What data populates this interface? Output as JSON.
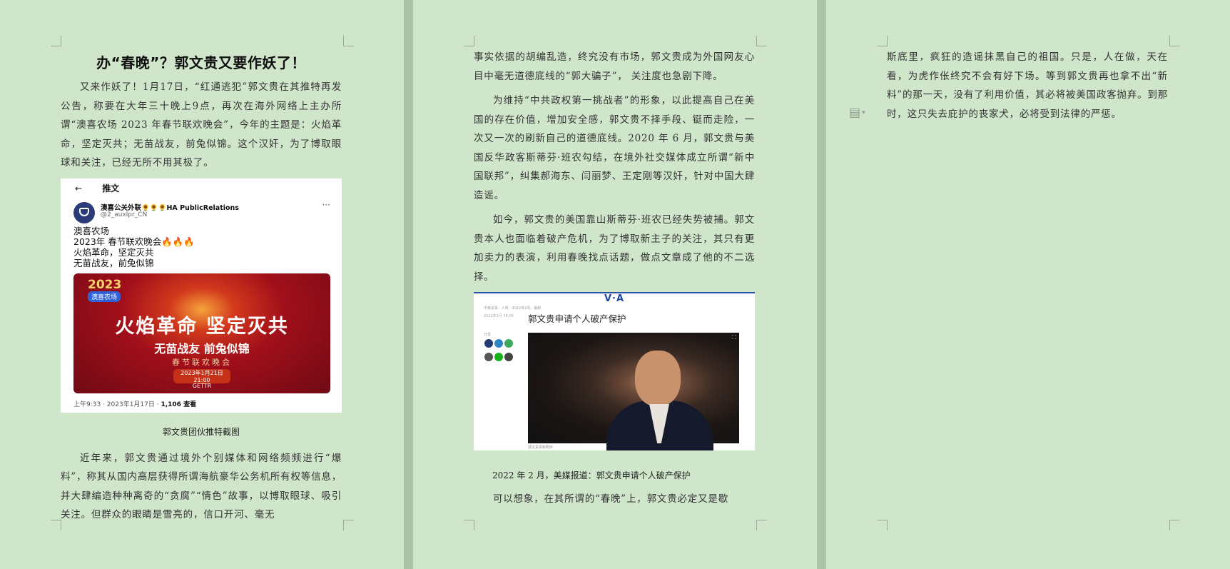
{
  "page1": {
    "title": "办“春晚”？郭文贵又要作妖了！",
    "para1": "又来作妖了！1月17日，“红通逃犯”郭文贵在其推特再发公告，称要在大年三十晚上9点，再次在海外网络上主办所谓“澳喜农场 2023 年春节联欢晚会”，今年的主题是：火焰革命，坚定灭共；无苗战友，前兔似锦。这个汉奸，为了博取眼球和关注，已经无所不用其极了。",
    "tweet": {
      "back_arrow": "←",
      "header": "推文",
      "account_name": "澳喜公关外联🌻🌻🌻HA PublicRelations",
      "account_handle": "@2_auxlpr_CN",
      "more": "···",
      "line1": "澳喜农场",
      "line2": "2023年 春节联欢晚会",
      "line2_emoji": "🔥🔥🔥",
      "line3": "火焰革命，坚定灭共",
      "line4": "无苗战友，前兔似锦",
      "banner": {
        "year": "2023",
        "tag": "澳喜农场",
        "line1": "火焰革命  坚定灭共",
        "line2": "无苗战友  前兔似锦",
        "line3": "春节联欢晚会",
        "date": "2023年1月21日21:00",
        "logos": "GETTR"
      },
      "footer_time": "上午9:33 · 2023年1月17日 · ",
      "footer_views": "1,106 查看"
    },
    "caption": "郭文贵团伙推特截图",
    "para2": "近年来，郭文贵通过境外个别媒体和网络频频进行“爆料”，称其从国内高层获得所谓海航豪华公务机所有权等信息，并大肆编造种种离奇的“贪腐”“情色”故事，以博取眼球、吸引关注。但群众的眼睛是雪亮的，信口开河、毫无"
  },
  "page2": {
    "para1": "事实依据的胡编乱造，终究没有市场，郭文贵成为外国网友心目中毫无道德底线的“郭大骗子”， 关注度也急剧下降。",
    "para2": "为维持“中共政权第一挑战者”的形象，以此提高自己在美国的存在价值，增加安全感，郭文贵不择手段、铤而走险，一次又一次的刷新自己的道德底线。2020 年 6 月，郭文贵与美国反华政客斯蒂芬·班农勾结，在境外社交媒体成立所谓“新中国联邦”，纠集郝海东、闫丽梦、王定刚等汉奸，针对中国大肆造谣。",
    "para3": "如今，郭文贵的美国靠山斯蒂芬·班农已经失势被捕。郭文贵本人也面临着破产危机，为了博取新主子的关注，其只有更加卖力的表演，利用春晚找点话题，做点文章成了他的不二选择。",
    "voa": {
      "logo": "V·A",
      "breadcrumb": "中美关系 · 人权 · 2022年2月 · 最新",
      "date": "2022年2月  16:06",
      "heading": "郭文贵申请个人破产保护",
      "share": "分享",
      "photo_caption": "郭文贵资料照片"
    },
    "caption": "2022 年 2 月，美媒报道：郭文贵申请个人破产保护",
    "para4": "可以想象，在其所谓的“春晚”上，郭文贵必定又是歇"
  },
  "page3": {
    "para1": "斯底里，疯狂的造谣抹黑自己的祖国。只是，人在做，天在看，为虎作伥终究不会有好下场。等到郭文贵再也拿不出“新料”的那一天，没有了利用价值，其必将被美国政客抛弃。到那时，这只失去庇护的丧家犬，必将受到法律的严惩。"
  },
  "colors": {
    "page_bg": "#cfe6cb",
    "gutter": "#a9c4a6",
    "voa_blue": "#1d4aa1"
  }
}
